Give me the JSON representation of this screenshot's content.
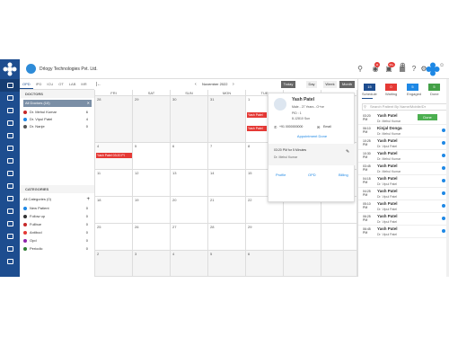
{
  "header": {
    "company": "Drlogy Technologies Pvt. Ltd.",
    "notif_badge": "11",
    "chat_badge": "99+"
  },
  "tabs": [
    "OPD",
    "IPD",
    "ICU",
    "OT",
    "LAB",
    "MR"
  ],
  "doctors": {
    "title": "DOCTORS",
    "filter": "All Doctors (10)",
    "items": [
      {
        "name": "Dr. Mehul Kumar",
        "count": "6",
        "color": "#c62828"
      },
      {
        "name": "Dr. Vipul Patel",
        "count": "4",
        "color": "#1e88e5"
      },
      {
        "name": "Dr. Nanje",
        "count": "0",
        "color": "#555555"
      }
    ]
  },
  "categories": {
    "title": "CATEGORIES",
    "all": "All Categories (0)",
    "items": [
      {
        "name": "New Patient",
        "count": "0",
        "color": "#1e88e5"
      },
      {
        "name": "Follow up",
        "count": "0",
        "color": "#333333"
      },
      {
        "name": "Fullbue",
        "count": "0",
        "color": "#c62828"
      },
      {
        "name": "Antibod",
        "count": "0",
        "color": "#e53935"
      },
      {
        "name": "Opd",
        "count": "0",
        "color": "#8e24aa"
      },
      {
        "name": "Periodic",
        "count": "0",
        "color": "#2e7d32"
      }
    ]
  },
  "calendar": {
    "month": "November 2022",
    "today": "Today",
    "views": [
      "Day",
      "Week",
      "Month"
    ],
    "days": [
      "FRI",
      "SAT",
      "SUN",
      "MON",
      "TUE"
    ],
    "rows": [
      [
        "28",
        "29",
        "30",
        "31",
        "1"
      ],
      [
        "4",
        "5",
        "6",
        "7",
        "8"
      ],
      [
        "11",
        "12",
        "13",
        "14",
        "15"
      ],
      [
        "18",
        "19",
        "20",
        "21",
        "22"
      ],
      [
        "25",
        "26",
        "27",
        "28",
        "29"
      ],
      [
        "2",
        "3",
        "4",
        "5",
        "6"
      ]
    ],
    "events": {
      "e1": "Yash Patel",
      "e2": "Yash Patel",
      "e3": "Yash Patel 03:20 PI"
    }
  },
  "popup": {
    "name": "Yash Patel",
    "meta": "Male  -  27 Years  -  O+ve",
    "pid": "PID : 1",
    "id": "8-12810 Sun",
    "phone": "+91 0000000000",
    "email": "Email",
    "status": "Appointment Done",
    "time": "03:20 PM for 5 Minutes",
    "doctor": "Dr. Mehul Kumar",
    "actions": [
      "Profile",
      "OPD",
      "Billing"
    ]
  },
  "right_panel": {
    "stats": [
      {
        "value": "15",
        "label": "Schedule",
        "color": "#1d4d8f"
      },
      {
        "value": "0",
        "label": "Waiting",
        "color": "#e53935"
      },
      {
        "value": "5",
        "label": "Engaged",
        "color": "#1e88e5"
      },
      {
        "value": "5",
        "label": "Done",
        "color": "#43a047"
      }
    ],
    "search_placeholder": "Search Patient By Name/Mobile/Dr",
    "done_label": "Done",
    "appointments": [
      {
        "time": "03:20",
        "ampm": "PM",
        "name": "Yash Patel",
        "doctor": "Dr. Mehul Kumar"
      },
      {
        "time": "06:10",
        "ampm": "PM",
        "name": "Kinjal Donga",
        "doctor": "Dr. Mehul Kumar"
      },
      {
        "time": "10:25",
        "ampm": "PM",
        "name": "Yash Patel",
        "doctor": "Dr. Vipul Patel"
      },
      {
        "time": "10:30",
        "ampm": "PM",
        "name": "Yash Patel",
        "doctor": "Dr. Mehul Kumar"
      },
      {
        "time": "03:45",
        "ampm": "PM",
        "name": "Yash Patel",
        "doctor": "Dr. Mehul Kumar"
      },
      {
        "time": "04:15",
        "ampm": "PM",
        "name": "Yash Patel",
        "doctor": "Dr. Vipul Patel"
      },
      {
        "time": "04:25",
        "ampm": "PM",
        "name": "Yash Patel",
        "doctor": "Dr. Vipul Patel"
      },
      {
        "time": "05:10",
        "ampm": "PM",
        "name": "Yash Patel",
        "doctor": "Dr. Vipul Patel"
      },
      {
        "time": "06:25",
        "ampm": "PM",
        "name": "Yash Patel",
        "doctor": "Dr. Vipul Patel"
      },
      {
        "time": "06:45",
        "ampm": "PM",
        "name": "Yash Patel",
        "doctor": "Dr. Vipul Patel"
      }
    ]
  }
}
